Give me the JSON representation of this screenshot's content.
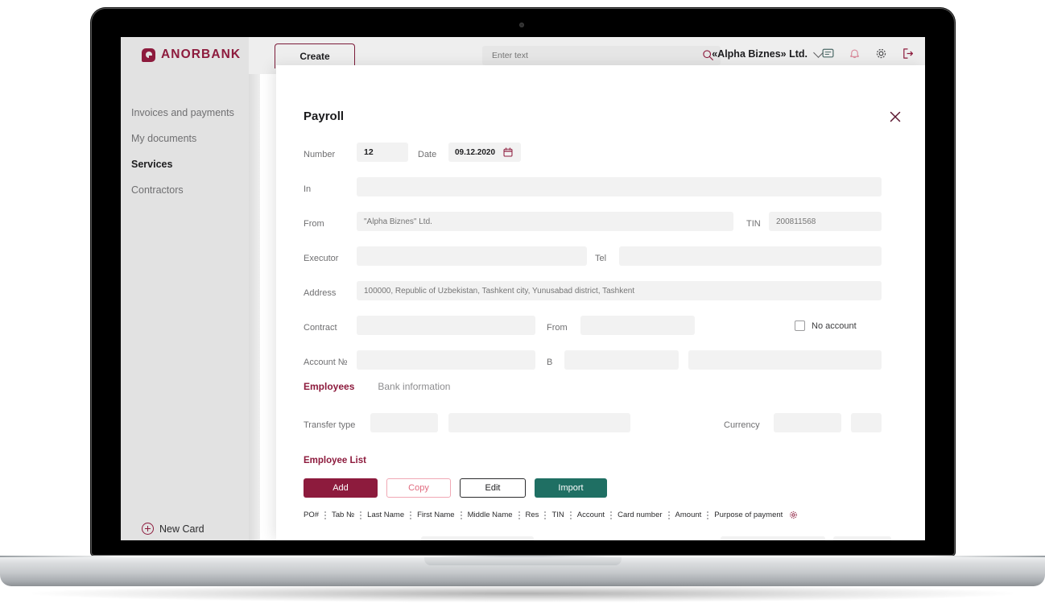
{
  "brand": {
    "name": "ANORBANK",
    "primary": "#8d1b3d",
    "accent_teal": "#1f6f63",
    "accent_pink": "#e06a7e"
  },
  "sidebar": {
    "items": [
      {
        "label": "Invoices and payments",
        "active": false
      },
      {
        "label": "My documents",
        "active": false
      },
      {
        "label": "Services",
        "active": true
      },
      {
        "label": "Contractors",
        "active": false
      }
    ],
    "new_card_label": "New Card"
  },
  "topbar": {
    "create_tab": "Create",
    "search_placeholder": "Enter text",
    "search_value": "",
    "company": "«Alpha Biznes» Ltd.",
    "icons": [
      "message-icon",
      "bell-icon",
      "gear-icon",
      "logout-icon"
    ]
  },
  "modal": {
    "title": "Payroll",
    "close_label": "×",
    "fields": {
      "number_label": "Number",
      "number_value": "12",
      "date_label": "Date",
      "date_value": "09.12.2020",
      "in_label": "In",
      "in_value": "",
      "from_label": "From",
      "from_placeholder": "\"Alpha Biznes\" Ltd.",
      "tin_label": "TIN",
      "tin_placeholder": "200811568",
      "executor_label": "Executor",
      "executor_value": "",
      "tel_label": "Tel",
      "tel_value": "",
      "address_label": "Address",
      "address_placeholder": "100000, Republic of Uzbekistan, Tashkent city, Yunusabad district, Tashkent",
      "contract_label": "Contract",
      "contract_value": "",
      "contract_from_label": "From",
      "contract_from_value": "",
      "no_account_label": "No account",
      "no_account_checked": false,
      "account_label": "Account №",
      "account_value": "",
      "b_label": "B",
      "b_value": "",
      "b_extra_value": ""
    },
    "tabs": [
      {
        "label": "Employees",
        "active": true
      },
      {
        "label": "Bank information",
        "active": false
      }
    ],
    "transfer": {
      "transfer_type_label": "Transfer type",
      "transfer_type_value": "",
      "transfer_detail_value": "",
      "currency_label": "Currency",
      "currency_value": "",
      "currency_code_value": ""
    },
    "employee_list": {
      "section_title": "Employee List",
      "buttons": [
        {
          "label": "Add",
          "style": "add"
        },
        {
          "label": "Copy",
          "style": "copy"
        },
        {
          "label": "Edit",
          "style": "edit"
        },
        {
          "label": "Import",
          "style": "import"
        }
      ],
      "columns": [
        "PO#",
        "Tab №",
        "Last Name",
        "First Name",
        "Middle Name",
        "Res",
        "TIN",
        "Account",
        "Card number",
        "Amount",
        "Purpose of payment"
      ],
      "settings_icon": "gear-icon"
    }
  }
}
